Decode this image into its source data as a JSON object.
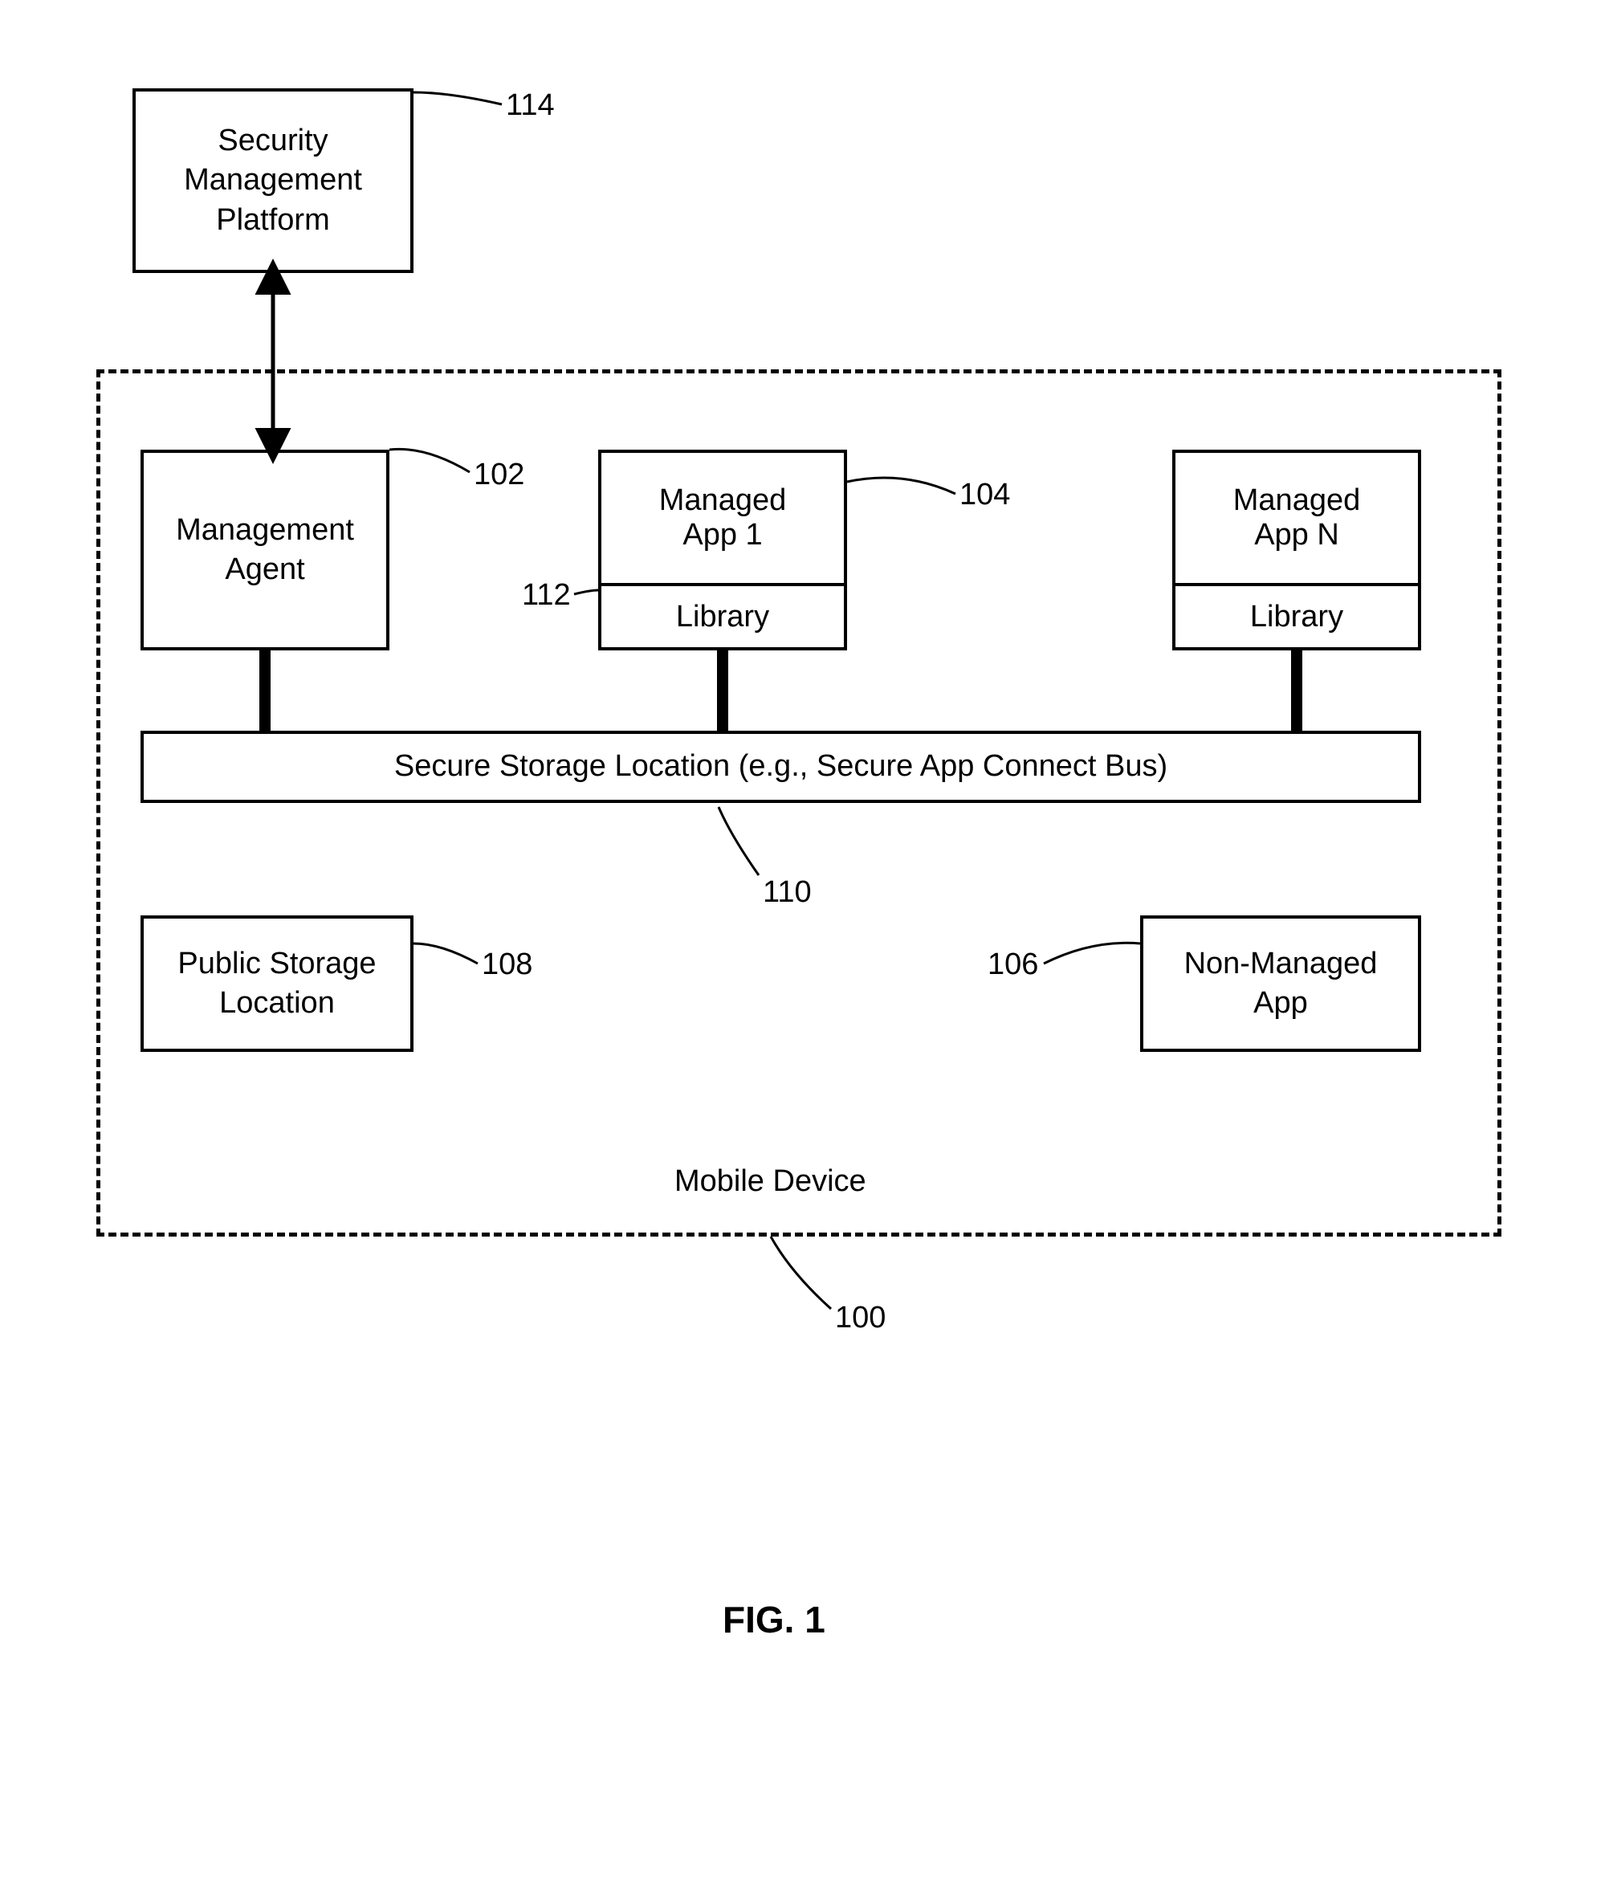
{
  "boxes": {
    "security_platform": "Security\nManagement\nPlatform",
    "management_agent": "Management\nAgent",
    "managed_app_1": "Managed\nApp 1",
    "managed_app_n": "Managed\nApp N",
    "library": "Library",
    "secure_storage": "Secure Storage Location (e.g., Secure App Connect Bus)",
    "public_storage": "Public Storage\nLocation",
    "non_managed_app": "Non-Managed\nApp",
    "mobile_device": "Mobile Device"
  },
  "refs": {
    "r100": "100",
    "r102": "102",
    "r104": "104",
    "r106": "106",
    "r108": "108",
    "r110": "110",
    "r112": "112",
    "r114": "114"
  },
  "figure": "FIG. 1"
}
